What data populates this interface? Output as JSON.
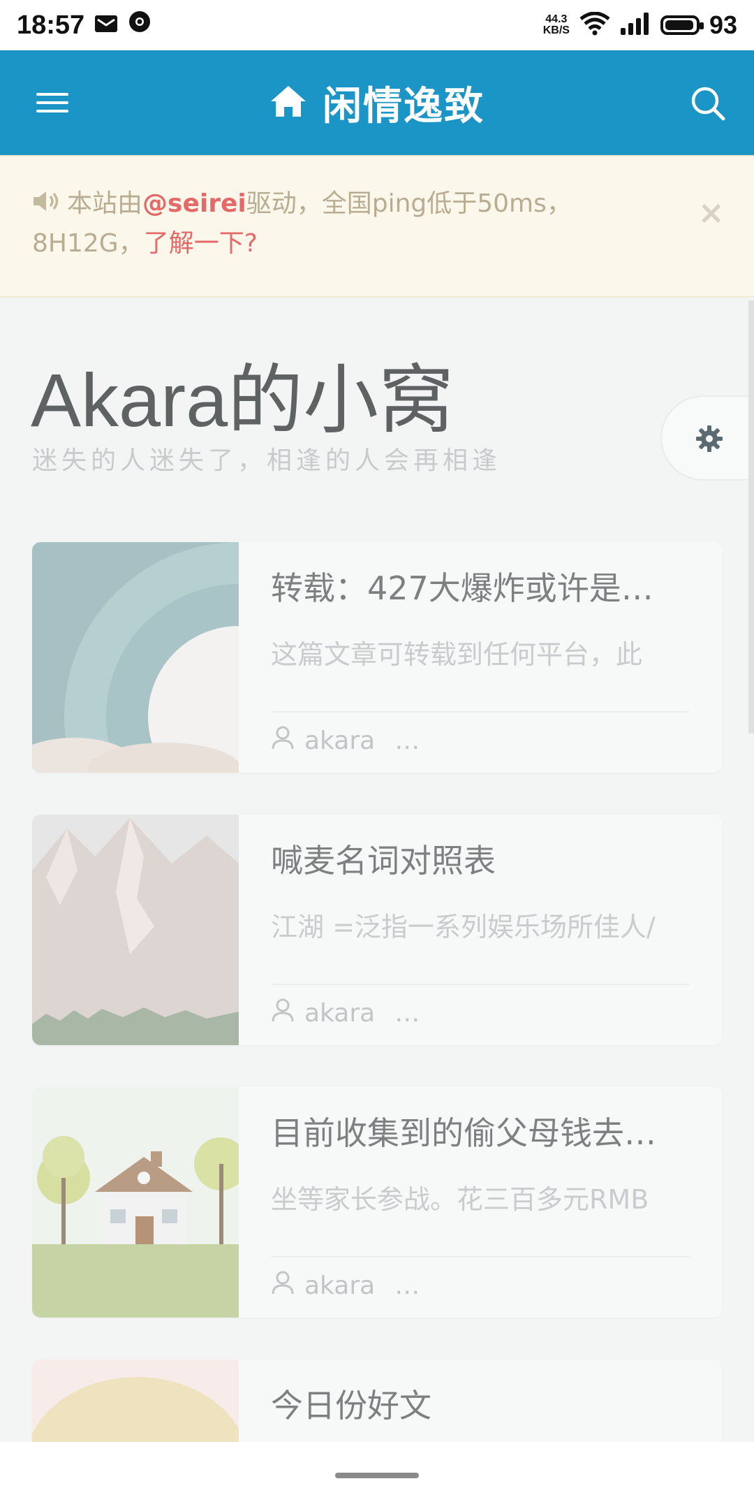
{
  "status_bar": {
    "time": "18:57",
    "net_speed_value": "44.3",
    "net_speed_unit": "KB/S",
    "battery": "93"
  },
  "header": {
    "title": "闲情逸致",
    "icons": {
      "menu": "menu-icon",
      "home": "home-icon",
      "search": "search-icon"
    },
    "color": "#1b95c6"
  },
  "notice": {
    "prefix": "本站由",
    "mention": "@seirei",
    "text": "驱动，全国ping低于50ms，8H12G，",
    "link": "了解一下?",
    "close": "×"
  },
  "site": {
    "title": "Akara的小窝",
    "subtitle": "迷失的人迷失了，相逢的人会再相逢"
  },
  "posts": [
    {
      "title": "转载：427大爆炸或许是…",
      "excerpt": "这篇文章可转载到任何平台，此",
      "author": "akara",
      "more": "…"
    },
    {
      "title": "喊麦名词对照表",
      "excerpt": "江湖 =泛指一系列娱乐场所佳人/",
      "author": "akara",
      "more": "…"
    },
    {
      "title": "目前收集到的偷父母钱去…",
      "excerpt": "坐等家长参战。花三百多元RMB",
      "author": "akara",
      "more": "…"
    },
    {
      "title": "今日份好文"
    }
  ]
}
